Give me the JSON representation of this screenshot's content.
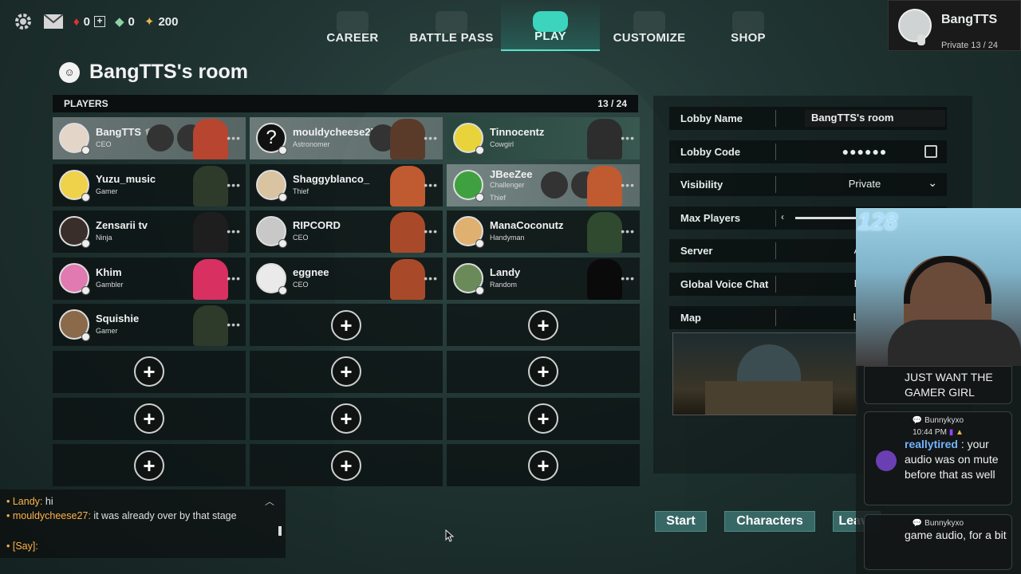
{
  "currency": {
    "hearts": "0",
    "gems": "0",
    "tickets": "200"
  },
  "nav": [
    {
      "label": "CAREER",
      "icon": "chart-icon"
    },
    {
      "label": "BATTLE PASS",
      "icon": "trophy-icon"
    },
    {
      "label": "PLAY",
      "icon": "gamepad-icon",
      "active": true
    },
    {
      "label": "CUSTOMIZE",
      "icon": "bow-icon"
    },
    {
      "label": "SHOP",
      "icon": "store-icon"
    }
  ],
  "profile": {
    "name": "BangTTS",
    "info": "Private 13 / 24"
  },
  "room": {
    "title": "BangTTS's room"
  },
  "players": {
    "header": "PLAYERS",
    "count": "13 / 24",
    "list": [
      {
        "name": "BangTTS",
        "role": "CEO"
      },
      {
        "name": "mouldycheese27",
        "role": "Astronomer"
      },
      {
        "name": "Tinnocentz",
        "role": "Cowgirl"
      },
      {
        "name": "Yuzu_music",
        "role": "Gamer"
      },
      {
        "name": "Shaggyblanco_",
        "role": "Thief"
      },
      {
        "name": "JBeeZee",
        "role": "Challenger",
        "role2": "Thief"
      },
      {
        "name": "Zensarii tv",
        "role": "Ninja"
      },
      {
        "name": "RIPCORD",
        "role": "CEO"
      },
      {
        "name": "ManaCoconutz",
        "role": "Handyman"
      },
      {
        "name": "Khim",
        "role": "Gambler"
      },
      {
        "name": "eggnee",
        "role": "CEO"
      },
      {
        "name": "Landy",
        "role": "Random"
      },
      {
        "name": "Squishie",
        "role": "Gamer"
      }
    ],
    "add_symbol": "+"
  },
  "settings": {
    "lobby_name": {
      "label": "Lobby Name",
      "value": "BangTTS's room"
    },
    "lobby_code": {
      "label": "Lobby Code",
      "value": "●●●●●●"
    },
    "visibility": {
      "label": "Visibility",
      "value": "Private"
    },
    "max_players": {
      "label": "Max Players",
      "value": "128"
    },
    "server": {
      "label": "Server",
      "value": "Auto"
    },
    "global_voice": {
      "label": "Global Voice Chat",
      "value": "Host"
    },
    "map": {
      "label": "Map",
      "value": "Lunu"
    }
  },
  "chat": {
    "messages": [
      {
        "user": "Landy",
        "text": "hi"
      },
      {
        "user": "mouldycheese27",
        "text": "it was already over by that stage"
      }
    ],
    "say_placeholder": "[Say]:"
  },
  "buttons": {
    "start": "Start",
    "characters": "Characters",
    "leave": "Leave"
  },
  "stream_chat": {
    "prev_message": "JUST WANT THE GAMER GIRL",
    "cards": [
      {
        "channel": "Bunnykyxo",
        "time": "10:44 PM",
        "user": "reallytired",
        "text": ": your audio was on mute before that as well"
      },
      {
        "channel": "Bunnykyxo",
        "text": "game audio, for a bit"
      }
    ]
  },
  "colors": {
    "accent": "#3cd4bd",
    "button": "#376866",
    "chat_user": "#ffb24a",
    "twitch_user": "#72b4ff"
  }
}
